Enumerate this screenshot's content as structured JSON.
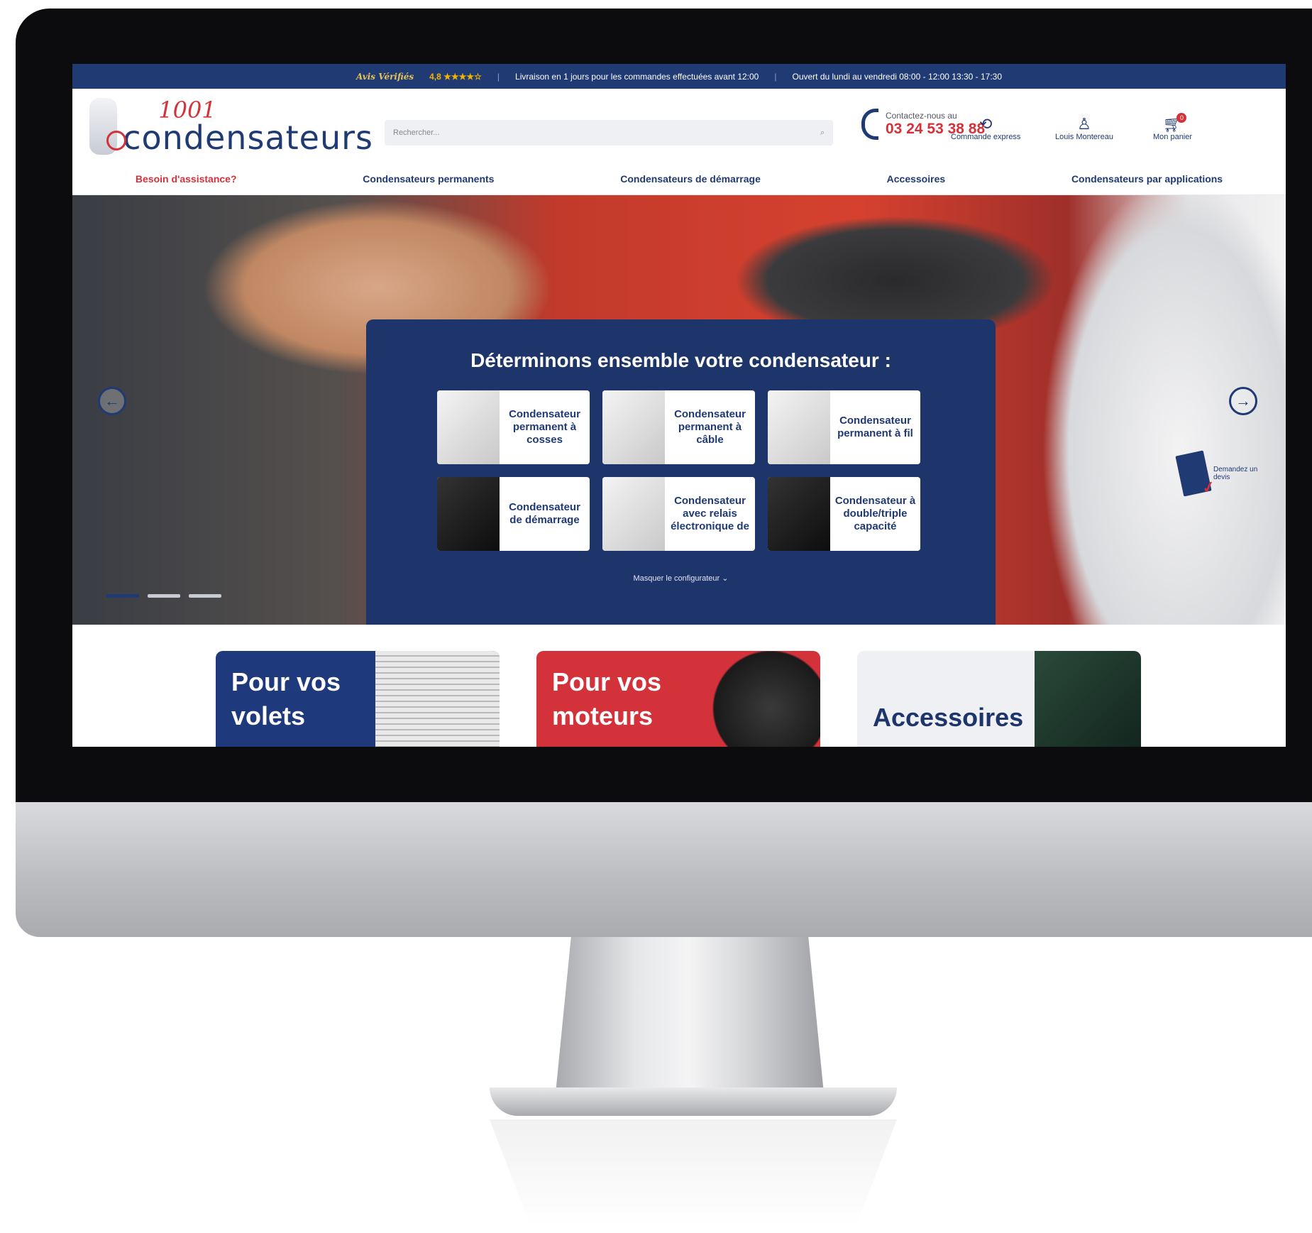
{
  "topbar": {
    "avis_brand": "Avis Vérifiés",
    "rating": "4,8 ★★★★☆",
    "delivery": "Livraison en 1 jours pour les commandes effectuées avant 12:00",
    "hours": "Ouvert du lundi au vendredi 08:00 - 12:00 13:30 - 17:30"
  },
  "header": {
    "logo_number": "1001",
    "logo_word": "condensateurs",
    "search_placeholder": "Rechercher...",
    "contact_label": "Contactez-nous au",
    "contact_phone": "03 24 53 38 88",
    "express_label": "Commande express",
    "account_label": "Louis Montereau",
    "cart_label": "Mon panier",
    "cart_count": "0"
  },
  "nav": {
    "items": [
      "Besoin d'assistance?",
      "Condensateurs permanents",
      "Condensateurs de démarrage",
      "Accessoires",
      "Condensateurs par applications"
    ]
  },
  "hero": {
    "configurator_title": "Déterminons ensemble votre condensateur :",
    "cards": [
      "Condensateur permanent à cosses",
      "Condensateur permanent à câble",
      "Condensateur permanent à fil",
      "Condensateur de démarrage",
      "Condensateur avec relais électronique de",
      "Condensateur à double/triple capacité"
    ],
    "hide_label": "Masquer le configurateur",
    "devis_label": "Demandez un devis",
    "slides": 3,
    "active_slide": 1
  },
  "categories": [
    {
      "title": "Pour vos volets"
    },
    {
      "title": "Pour vos moteurs"
    },
    {
      "title": "Accessoires"
    }
  ],
  "colors": {
    "brand_blue": "#203a73",
    "brand_red": "#d4323a"
  }
}
